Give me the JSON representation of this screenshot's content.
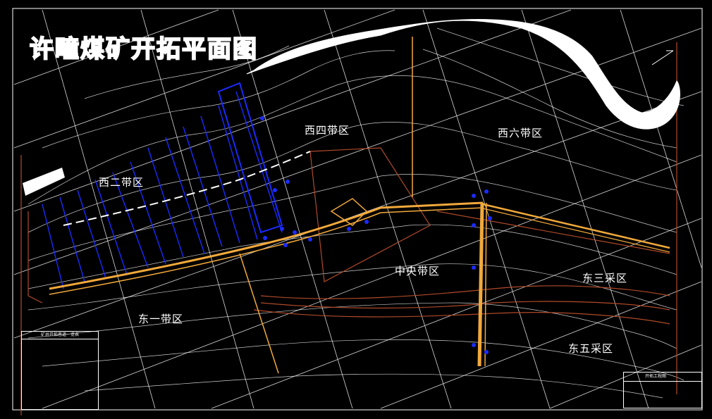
{
  "title": "许疃煤矿开拓平面图",
  "zones": {
    "west_four": "西四带区",
    "west_six": "西六带区",
    "west_two": "西二带区",
    "central": "中央带区",
    "east_three": "东三采区",
    "east_one": "东一带区",
    "east_five": "东五采区"
  },
  "legend": {
    "header": "矿井开拓巷道一览表"
  },
  "title_block": {
    "name": "开拓工程图"
  },
  "north_arrow": "N",
  "colors": {
    "background": "#000000",
    "contour": "#ffffff",
    "roadway": "#f2a93b",
    "workface": "#1a2bff",
    "boundary": "#b04a2a",
    "river": "#ffffff"
  }
}
